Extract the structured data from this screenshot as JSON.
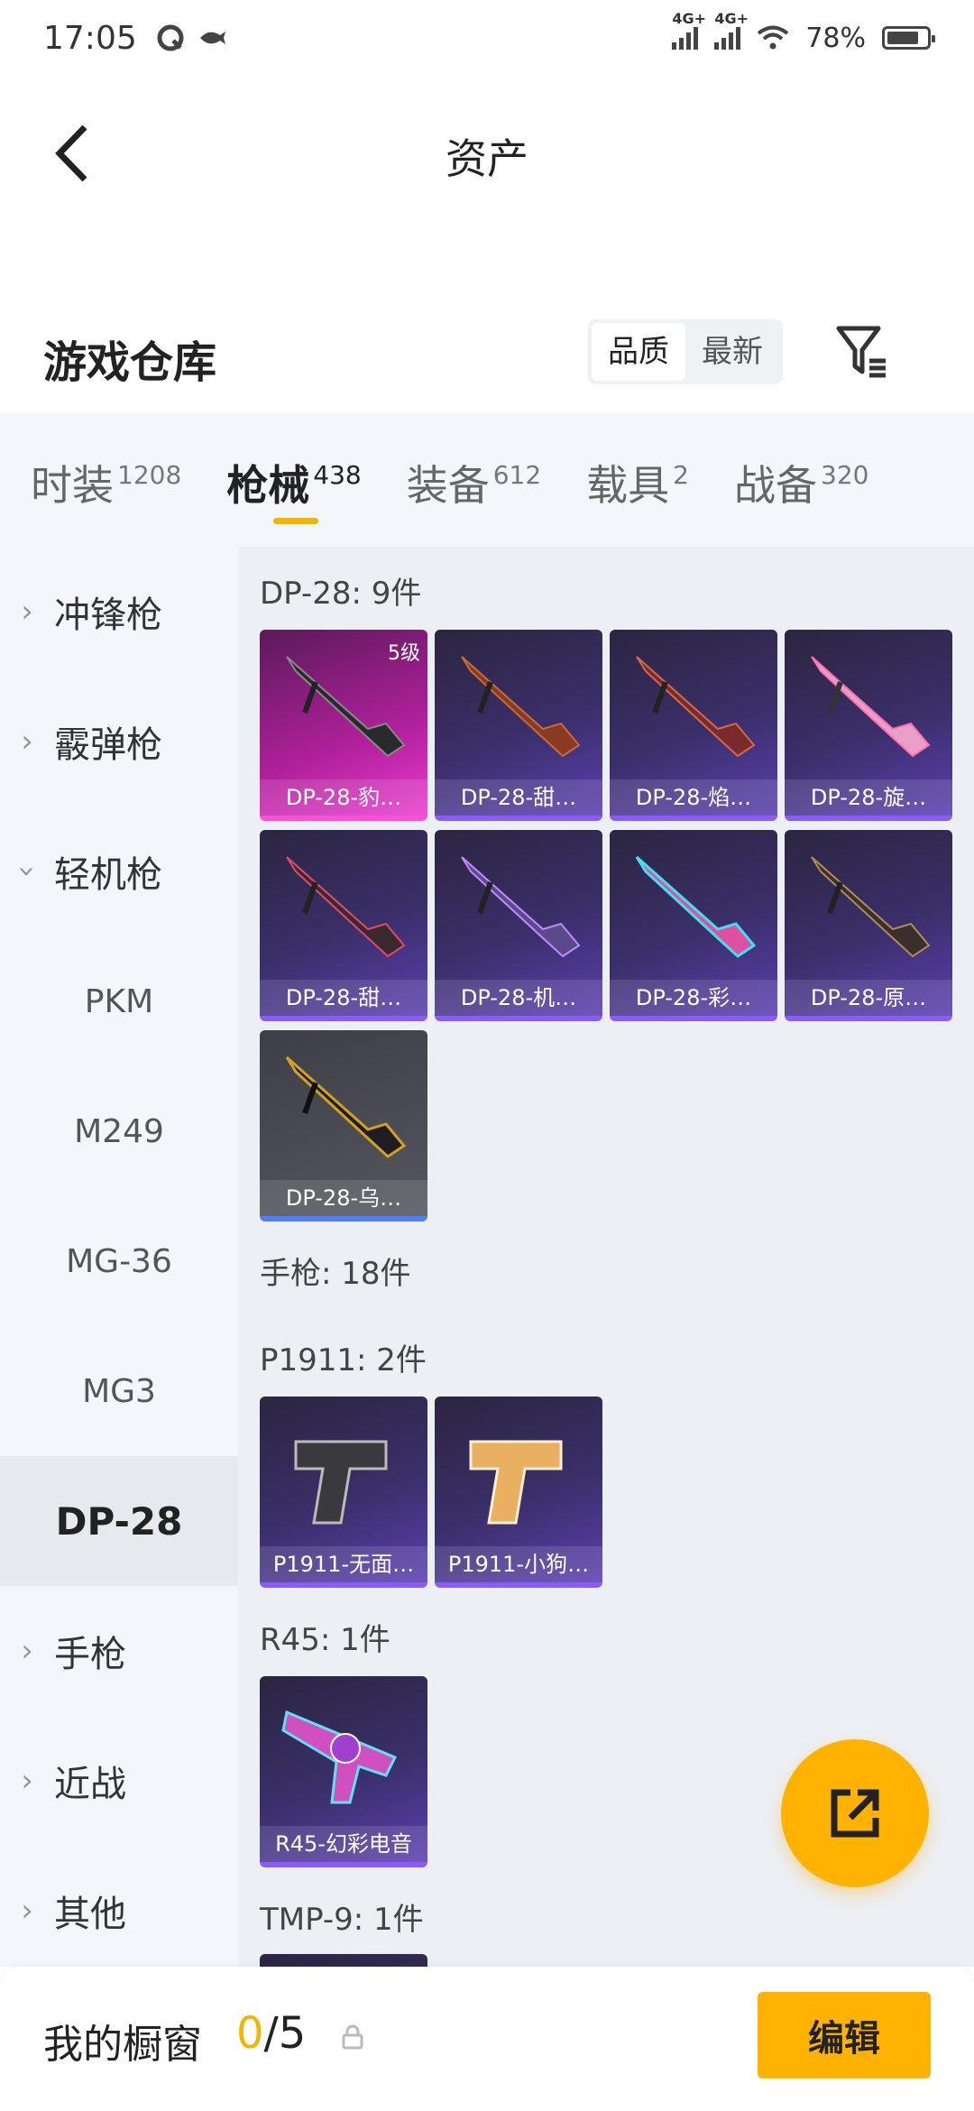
{
  "status_bar": {
    "time": "17:05",
    "network1": "4G+",
    "network2": "4G+",
    "battery": "78%"
  },
  "header": {
    "title": "资产"
  },
  "section": {
    "title": "游戏仓库",
    "sort_options": [
      "品质",
      "最新"
    ]
  },
  "category_tabs": [
    {
      "name": "时装",
      "count": "1208"
    },
    {
      "name": "枪械",
      "count": "438"
    },
    {
      "name": "装备",
      "count": "612"
    },
    {
      "name": "载具",
      "count": "2"
    },
    {
      "name": "战备",
      "count": "320"
    }
  ],
  "sidebar": {
    "items": [
      {
        "label": "冲锋枪"
      },
      {
        "label": "霰弹枪"
      },
      {
        "label": "轻机枪"
      },
      {
        "label": "PKM"
      },
      {
        "label": "M249"
      },
      {
        "label": "MG-36"
      },
      {
        "label": "MG3"
      },
      {
        "label": "DP-28"
      },
      {
        "label": "手枪"
      },
      {
        "label": "近战"
      },
      {
        "label": "其他"
      }
    ]
  },
  "content": {
    "groups": [
      {
        "title": "DP-28: 9件"
      },
      {
        "title": "手枪: 18件"
      },
      {
        "title": "P1911: 2件"
      },
      {
        "title": "R45: 1件"
      },
      {
        "title": "TMP-9: 1件"
      }
    ],
    "dp28_items": [
      {
        "label": "DP-28-豹…",
        "badge": "5级"
      },
      {
        "label": "DP-28-甜…"
      },
      {
        "label": "DP-28-焰…"
      },
      {
        "label": "DP-28-旋…"
      },
      {
        "label": "DP-28-甜…"
      },
      {
        "label": "DP-28-机…"
      },
      {
        "label": "DP-28-彩…"
      },
      {
        "label": "DP-28-原…"
      },
      {
        "label": "DP-28-乌…"
      }
    ],
    "p1911_items": [
      {
        "label": "P1911-无面…"
      },
      {
        "label": "P1911-小狗…"
      }
    ],
    "r45_items": [
      {
        "label": "R45-幻彩电音"
      }
    ]
  },
  "bottom_bar": {
    "label": "我的橱窗",
    "current": "0",
    "total": "/5",
    "edit_label": "编辑"
  }
}
